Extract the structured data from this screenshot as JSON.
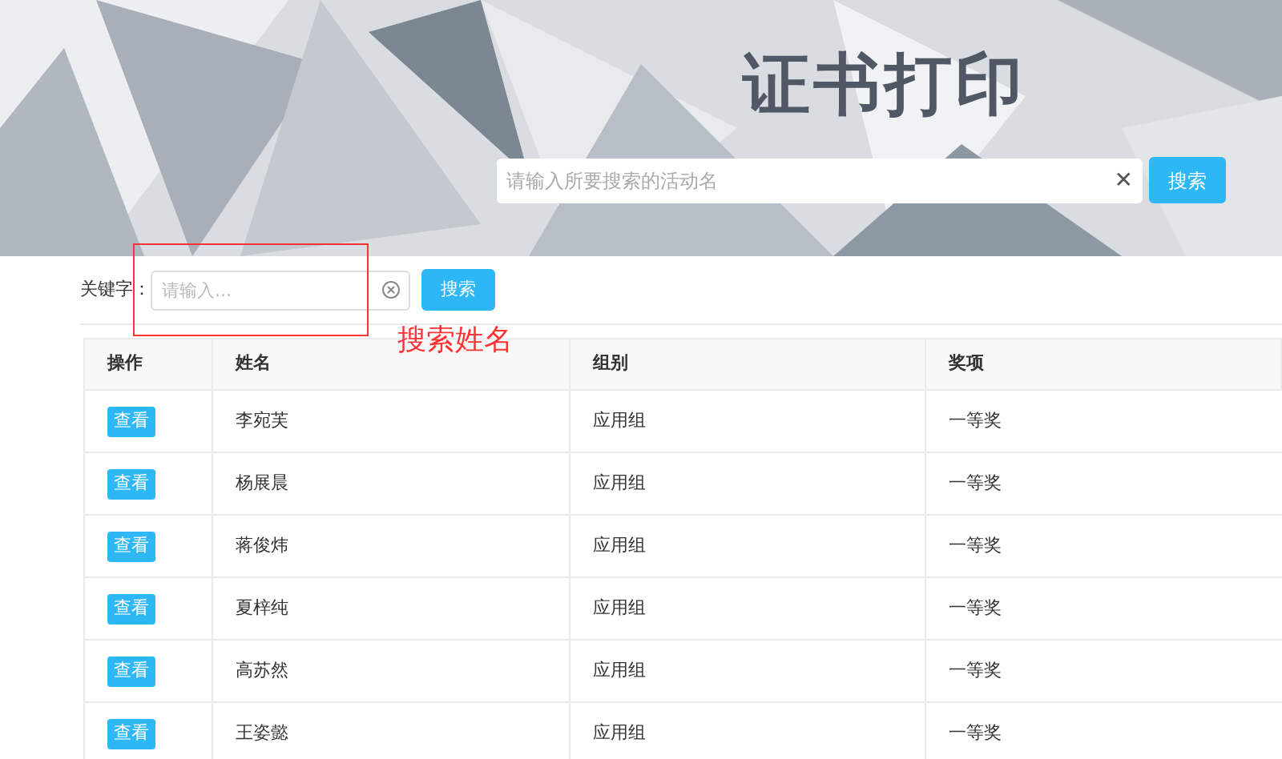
{
  "banner": {
    "kind": "picture",
    "title": "证书打印",
    "search": {
      "placeholder": "请输入所要搜索的活动名",
      "clear": "✕",
      "button": "搜索"
    }
  },
  "filter": {
    "label": "关键字：",
    "placeholder": "请输入...",
    "button": "搜索"
  },
  "annotation": {
    "text": "搜索姓名",
    "color": "#ff3333"
  },
  "table": {
    "columns": [
      "操作",
      "姓名",
      "组别",
      "奖项"
    ],
    "rows": [
      {
        "action": "查看",
        "name": "李宛芙",
        "group": "应用组",
        "award": "一等奖"
      },
      {
        "action": "查看",
        "name": "杨展晨",
        "group": "应用组",
        "award": "一等奖"
      },
      {
        "action": "查看",
        "name": "蒋俊炜",
        "group": "应用组",
        "award": "一等奖"
      },
      {
        "action": "查看",
        "name": "夏梓纯",
        "group": "应用组",
        "award": "一等奖"
      },
      {
        "action": "查看",
        "name": "高苏然",
        "group": "应用组",
        "award": "一等奖"
      },
      {
        "action": "查看",
        "name": "王姿懿",
        "group": "应用组",
        "award": "一等奖"
      }
    ]
  }
}
